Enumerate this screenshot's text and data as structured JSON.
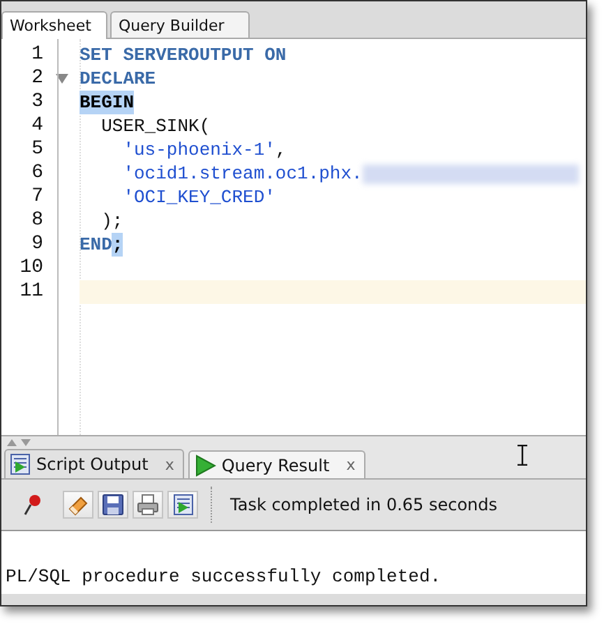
{
  "editor_tabs": [
    {
      "label": "Worksheet",
      "selected": true
    },
    {
      "label": "Query Builder",
      "selected": false
    }
  ],
  "code_lines": [
    {
      "number": "1",
      "fold": false,
      "current": false,
      "tokens": [
        {
          "kind": "keyword",
          "text": "SET SERVEROUTPUT ON",
          "highlighted": false
        }
      ]
    },
    {
      "number": "2",
      "fold": true,
      "current": false,
      "tokens": [
        {
          "kind": "keyword",
          "text": "DECLARE",
          "highlighted": false
        }
      ]
    },
    {
      "number": "3",
      "fold": false,
      "current": false,
      "tokens": [
        {
          "kind": "keyword",
          "text": "BEGIN",
          "highlighted": true
        }
      ]
    },
    {
      "number": "4",
      "fold": false,
      "current": false,
      "tokens": [
        {
          "kind": "plain",
          "text": "  USER_SINK(",
          "highlighted": false
        }
      ]
    },
    {
      "number": "5",
      "fold": false,
      "current": false,
      "tokens": [
        {
          "kind": "string",
          "text": "    'us-phoenix-1'",
          "highlighted": false
        },
        {
          "kind": "plain",
          "text": ",",
          "highlighted": false
        }
      ]
    },
    {
      "number": "6",
      "fold": false,
      "current": false,
      "tokens": [
        {
          "kind": "string",
          "text": "    'ocid1.stream.oc1.phx.",
          "highlighted": false
        },
        {
          "kind": "redacted"
        }
      ]
    },
    {
      "number": "7",
      "fold": false,
      "current": false,
      "tokens": [
        {
          "kind": "string",
          "text": "    'OCI_KEY_CRED'",
          "highlighted": false
        }
      ]
    },
    {
      "number": "8",
      "fold": false,
      "current": false,
      "tokens": [
        {
          "kind": "plain",
          "text": "  );",
          "highlighted": false
        }
      ]
    },
    {
      "number": "9",
      "fold": false,
      "current": false,
      "tokens": [
        {
          "kind": "keyword",
          "text": "END",
          "highlighted": false
        },
        {
          "kind": "keyword",
          "text": ";",
          "highlighted": true
        }
      ]
    },
    {
      "number": "10",
      "fold": false,
      "current": false
    },
    {
      "number": "11",
      "fold": false,
      "current": true
    }
  ],
  "output_tabs": [
    {
      "label": "Script Output",
      "close": "x",
      "selected": true
    },
    {
      "label": "Query Result",
      "close": "x",
      "selected": false
    }
  ],
  "toolbar": {
    "buttons": [
      {
        "kind": "pin"
      },
      {
        "kind": "eraser"
      },
      {
        "kind": "save"
      },
      {
        "kind": "print"
      },
      {
        "kind": "script"
      }
    ],
    "status": "Task completed in 0.65 seconds"
  },
  "output_text": "PL/SQL procedure successfully completed."
}
